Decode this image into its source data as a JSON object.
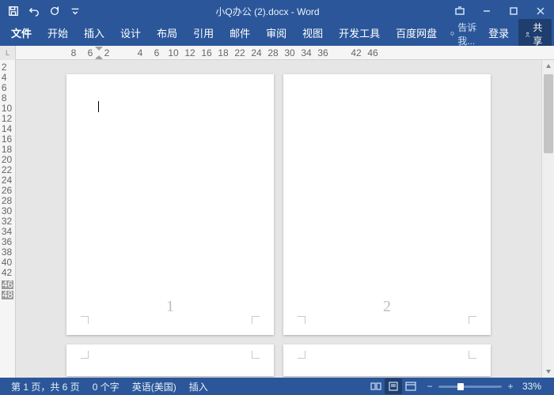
{
  "title": "小Q办公 (2).docx - Word",
  "qat": {
    "save": "save",
    "undo": "undo",
    "redo": "redo",
    "customize": "customize"
  },
  "ribbon": {
    "file": "文件",
    "tabs": [
      "开始",
      "插入",
      "设计",
      "布局",
      "引用",
      "邮件",
      "审阅",
      "视图",
      "开发工具",
      "百度网盘"
    ],
    "tell": "告诉我...",
    "signin": "登录",
    "share": "共享"
  },
  "hruler": {
    "corner": "L",
    "nums": [
      "8",
      "6",
      "2",
      "",
      "4",
      "6",
      "10",
      "12",
      "16",
      "18",
      "22",
      "24",
      "28",
      "30",
      "34",
      "36",
      "",
      "42",
      "46"
    ]
  },
  "vruler": {
    "nums": [
      "2",
      "4",
      "6",
      "8",
      "10",
      "12",
      "14",
      "16",
      "18",
      "20",
      "22",
      "24",
      "26",
      "28",
      "30",
      "32",
      "34",
      "36",
      "38",
      "40",
      "42",
      "",
      "46",
      "48"
    ]
  },
  "pages": [
    {
      "num": "1"
    },
    {
      "num": "2"
    },
    {
      "num": ""
    },
    {
      "num": ""
    }
  ],
  "status": {
    "page": "第 1 页，共 6 页",
    "words": "0 个字",
    "lang": "英语(美国)",
    "mode": "插入",
    "zoom": "33%"
  }
}
